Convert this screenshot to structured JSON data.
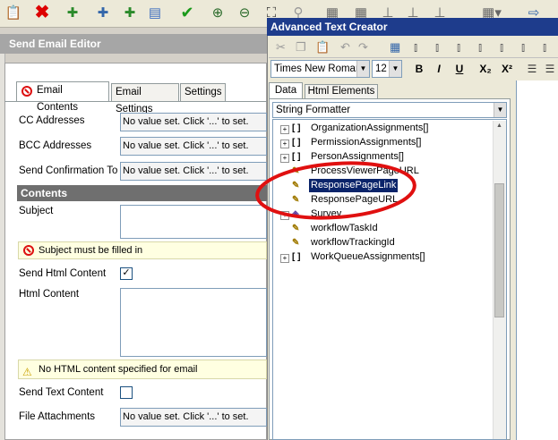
{
  "toolbar": {
    "icons": [
      "clipboard-icon",
      "delete-icon",
      "puzzle-icon",
      "puzzle-split-icon",
      "puzzle-add-icon",
      "document-icon",
      "checkmark-icon",
      "zoom-in-icon",
      "zoom-out-icon",
      "fit-icon",
      "search-icon",
      "grid-icon",
      "grid2-icon",
      "align-icon",
      "chart-icon",
      "table-icon",
      "grid-menu-icon",
      "export-icon"
    ]
  },
  "email_editor": {
    "title": "Send Email Editor",
    "tabs": [
      "Email Contents",
      "Email Settings",
      "Settings"
    ],
    "fields": {
      "cc_label": "CC Addresses",
      "cc_value": "No value set. Click '...' to set.",
      "bcc_label": "BCC Addresses",
      "bcc_value": "No value set. Click '...' to set.",
      "confirm_label": "Send Confirmation To",
      "confirm_value": "No value set. Click '...' to set.",
      "section": "Contents",
      "subject_label": "Subject",
      "subject_warning": "Subject must be filled in",
      "html_label": "Send Html Content",
      "html_checked": "✓",
      "html_content_label": "Html Content",
      "html_warning": "No HTML content specified for email",
      "text_label": "Send Text Content",
      "attach_label": "File Attachments",
      "attach_value": "No value set. Click '...' to set."
    }
  },
  "text_creator": {
    "title": "Advanced Text Creator",
    "font": "Times New Roman",
    "size": "12",
    "format_buttons": [
      "B",
      "I",
      "U",
      "X₂",
      "X²"
    ],
    "tabs": [
      "Data",
      "Html Elements"
    ],
    "formatter": "String Formatter",
    "tree": [
      {
        "label": "OrganizationAssignments[]",
        "icon": "[ ]",
        "expand": "+"
      },
      {
        "label": "PermissionAssignments[]",
        "icon": "[ ]",
        "expand": "+"
      },
      {
        "label": "PersonAssignments[]",
        "icon": "[ ]",
        "expand": "+"
      },
      {
        "label": "ProcessViewerPageURL",
        "icon": "✎",
        "expand": ""
      },
      {
        "label": "ResponsePageLink",
        "icon": "✎",
        "expand": ""
      },
      {
        "label": "ResponsePageURL",
        "icon": "✎",
        "expand": ""
      },
      {
        "label": "Survey",
        "icon": "◈",
        "expand": "+"
      },
      {
        "label": "workflowTaskId",
        "icon": "✎",
        "expand": ""
      },
      {
        "label": "workflowTrackingId",
        "icon": "✎",
        "expand": ""
      },
      {
        "label": "WorkQueueAssignments[]",
        "icon": "[ ]",
        "expand": "+"
      }
    ]
  },
  "colors": {
    "highlight": "#0a246a",
    "annotation": "#e01010"
  }
}
